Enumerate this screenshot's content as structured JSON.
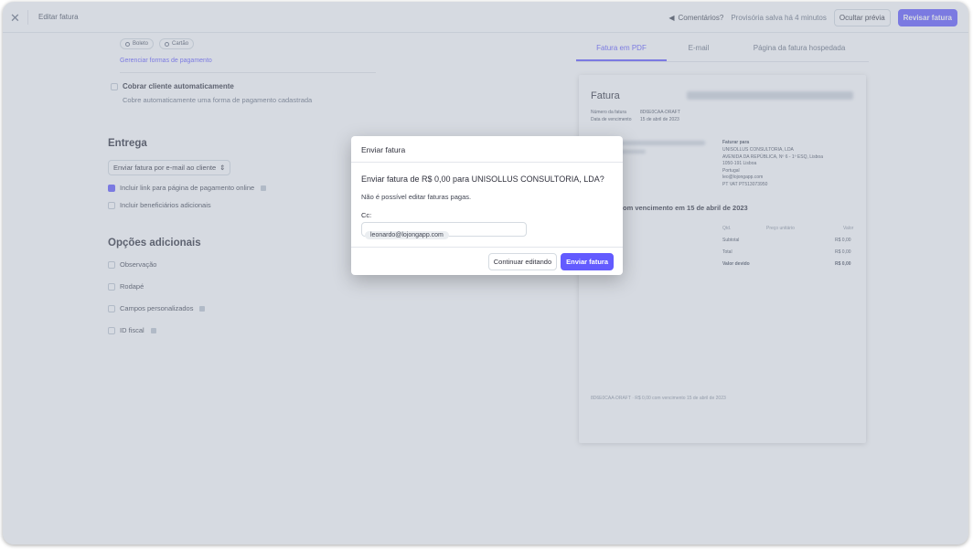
{
  "topbar": {
    "close_glyph": "✕",
    "title": "Editar fatura",
    "comments_label": "Comentários?",
    "saved_status": "Provisória salva há 4 minutos",
    "hide_preview_label": "Ocultar prévia",
    "review_label": "Revisar fatura"
  },
  "payment": {
    "methods": [
      "Boleto",
      "Cartão"
    ],
    "manage_link": "Gerenciar formas de pagamento",
    "auto_charge_label": "Cobrar cliente automaticamente",
    "auto_charge_desc": "Cobre automaticamente uma forma de pagamento cadastrada"
  },
  "delivery": {
    "title": "Entrega",
    "select_value": "Enviar fatura por e-mail ao cliente",
    "include_link_label": "Incluir link para página de pagamento online",
    "include_beneficiaries_label": "Incluir beneficiários adicionais"
  },
  "extra": {
    "title": "Opções adicionais",
    "options": [
      "Observação",
      "Rodapé",
      "Campos personalizados",
      "ID fiscal"
    ]
  },
  "preview": {
    "tabs": [
      "Fatura em PDF",
      "E-mail",
      "Página da fatura hospedada"
    ],
    "doc": {
      "heading": "Fatura",
      "number_label": "Número da fatura",
      "number_value": "8D6E0CAA-DRAFT",
      "due_label": "Data de vencimento",
      "due_value": "15 de abril de 2023",
      "bill_to_title": "Faturar para",
      "bill_to_lines": [
        "UNISOLLUS CONSULTORIA, LDA",
        "AVENIDA DA REPÚBLICA, Nº 6 - 1º ESQ, Lisboa",
        "1050-191 Lisboa",
        "Portugal",
        "leo@lojongapp.com",
        "PT VAT PT513073950"
      ],
      "due_headline": "om vencimento em 15 de abril de 2023",
      "col_qty": "Qtd.",
      "col_unit": "Preço unitário",
      "col_value": "Valor",
      "subtotal_label": "Subtotal",
      "subtotal_value": "R$ 0,00",
      "total_label": "Total",
      "total_value": "R$ 0,00",
      "due_amount_label": "Valor devido",
      "due_amount_value": "R$ 0,00",
      "footer": "8D6E0CAA-DRAFT · R$ 0,00 com vencimento 15 de abril de 2023"
    }
  },
  "modal": {
    "header": "Enviar fatura",
    "title": "Enviar fatura de R$ 0,00 para UNISOLLUS CONSULTORIA, LDA?",
    "note": "Não é possível editar faturas pagas.",
    "cc_label": "Cc:",
    "cc_email": "leonardo@lojongapp.com",
    "cancel_label": "Continuar editando",
    "confirm_label": "Enviar fatura"
  },
  "colors": {
    "accent": "#635bff",
    "overlay": "#9ea7b8"
  }
}
